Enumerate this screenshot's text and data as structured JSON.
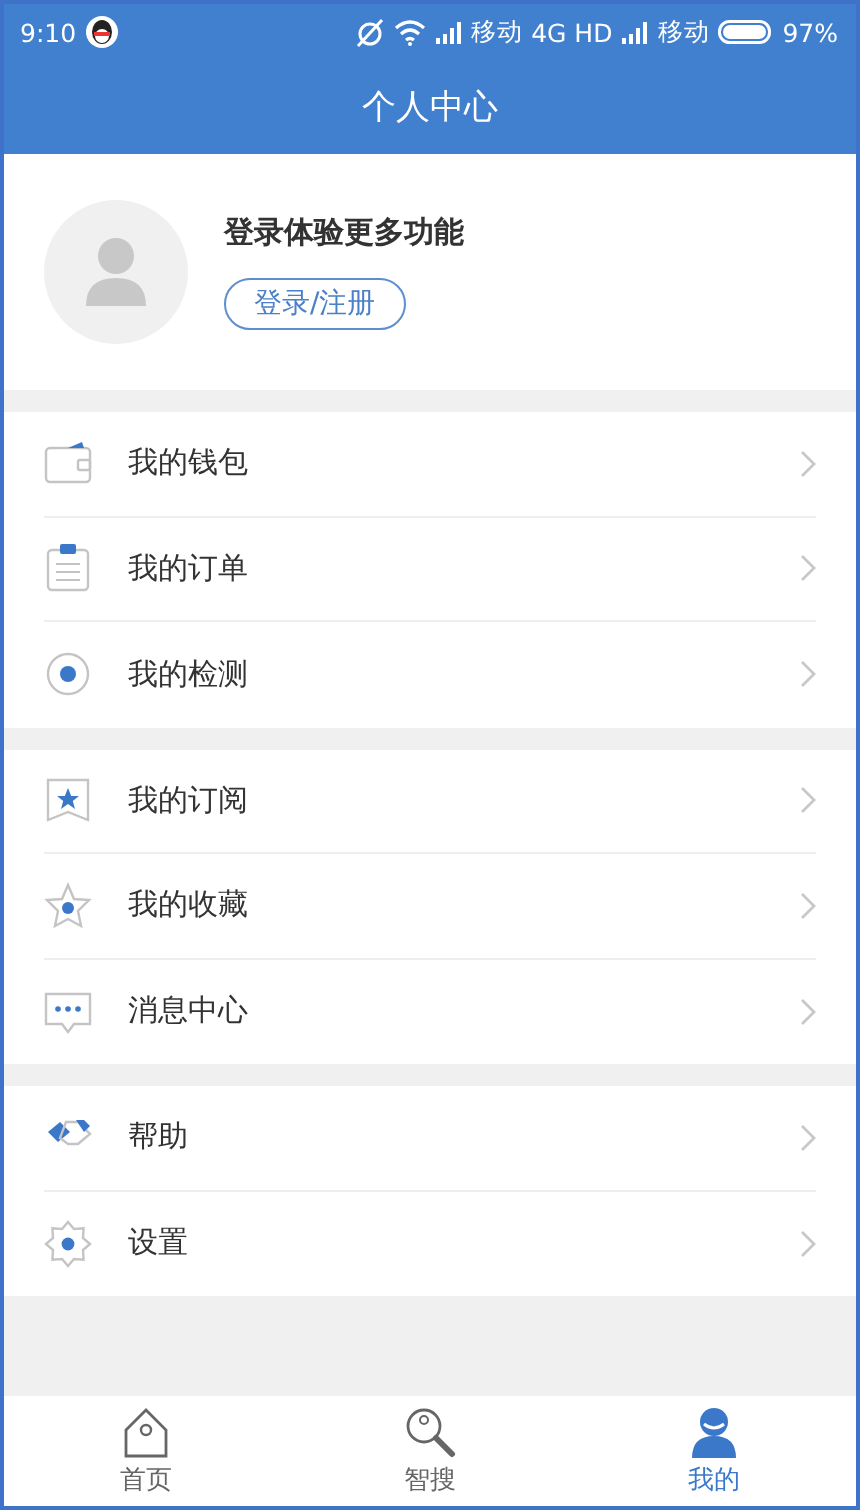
{
  "status_bar": {
    "time": "9:10",
    "carrier_1": "移动",
    "network": "4G HD",
    "carrier_2": "移动",
    "battery": "97%"
  },
  "header": {
    "title": "个人中心"
  },
  "profile": {
    "prompt": "登录体验更多功能",
    "login_button": "登录/注册"
  },
  "menu_groups": [
    {
      "items": [
        {
          "kind": "wallet",
          "label": "我的钱包"
        },
        {
          "kind": "order",
          "label": "我的订单"
        },
        {
          "kind": "scan",
          "label": "我的检测"
        }
      ]
    },
    {
      "items": [
        {
          "kind": "subscribe",
          "label": "我的订阅"
        },
        {
          "kind": "favorite",
          "label": "我的收藏"
        },
        {
          "kind": "message",
          "label": "消息中心"
        }
      ]
    },
    {
      "items": [
        {
          "kind": "help",
          "label": "帮助"
        },
        {
          "kind": "settings",
          "label": "设置"
        }
      ]
    }
  ],
  "tab_bar": [
    {
      "kind": "home",
      "label": "首页",
      "selected": false
    },
    {
      "kind": "search",
      "label": "智搜",
      "selected": false
    },
    {
      "kind": "me",
      "label": "我的",
      "selected": true
    }
  ]
}
